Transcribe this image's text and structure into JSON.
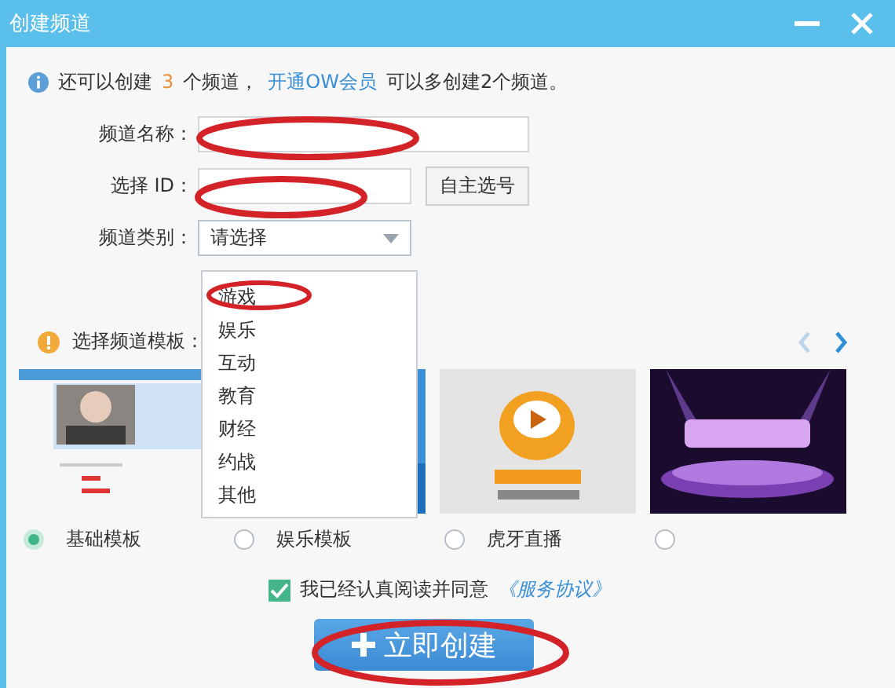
{
  "window": {
    "title": "创建频道"
  },
  "info": {
    "prefix": "还可以创建",
    "count": "3",
    "middle": "个频道，",
    "link": "开通OW会员",
    "suffix": "可以多创建2个频道。"
  },
  "form": [
    {
      "kind": "text",
      "label": "频道名称："
    },
    {
      "kind": "id",
      "label": "选择 ID：",
      "button": "自主选号"
    },
    {
      "kind": "select",
      "label": "频道类别：",
      "placeholder": "请选择",
      "expanded": true
    }
  ],
  "dropdown": [
    "游戏",
    "娱乐",
    "互动",
    "教育",
    "财经",
    "约战",
    "其他"
  ],
  "templates": {
    "heading": "选择频道模板：",
    "items": [
      {
        "label": "基础模板",
        "selected": true
      },
      {
        "label": "娱乐模板",
        "selected": false
      },
      {
        "label": "虎牙直播",
        "selected": false
      },
      {
        "selected": false
      }
    ]
  },
  "agreement": {
    "checked": true,
    "text": "我已经认真阅读并同意",
    "link": "《服务协议》"
  },
  "create_button": {
    "label": "立即创建"
  }
}
